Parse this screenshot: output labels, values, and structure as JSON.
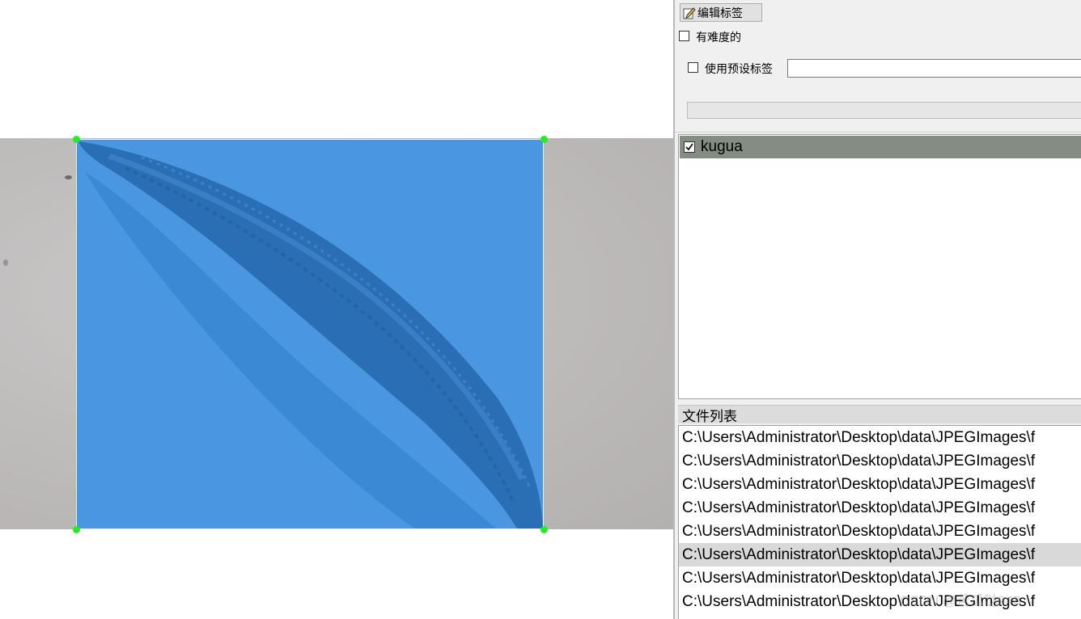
{
  "toolbar": {
    "edit_label_button": "编辑标签"
  },
  "options": {
    "difficult_label": "有难度的",
    "difficult_checked": false,
    "use_preset_label": "使用预设标签",
    "use_preset_checked": false,
    "preset_input_value": ""
  },
  "labels": {
    "items": [
      {
        "text": "kugua",
        "checked": true
      }
    ]
  },
  "file_list": {
    "title": "文件列表",
    "items": [
      "C:\\Users\\Administrator\\Desktop\\data\\JPEGImages\\f",
      "C:\\Users\\Administrator\\Desktop\\data\\JPEGImages\\f",
      "C:\\Users\\Administrator\\Desktop\\data\\JPEGImages\\f",
      "C:\\Users\\Administrator\\Desktop\\data\\JPEGImages\\f",
      "C:\\Users\\Administrator\\Desktop\\data\\JPEGImages\\f",
      "C:\\Users\\Administrator\\Desktop\\data\\JPEGImages\\f",
      "C:\\Users\\Administrator\\Desktop\\data\\JPEGImages\\f",
      "C:\\Users\\Administrator\\Desktop\\data\\JPEGImages\\f"
    ],
    "selected_index": 5
  },
  "watermark": "CSDN @苦瓜哒948",
  "colors": {
    "bbox_fill": "#4a96e0",
    "handle": "#22ee22",
    "label_row_bg": "#848c84",
    "selected_row_bg": "#d9d9d9"
  },
  "icons": {
    "edit": "pencil-edit-icon",
    "check": "checkmark-icon"
  }
}
